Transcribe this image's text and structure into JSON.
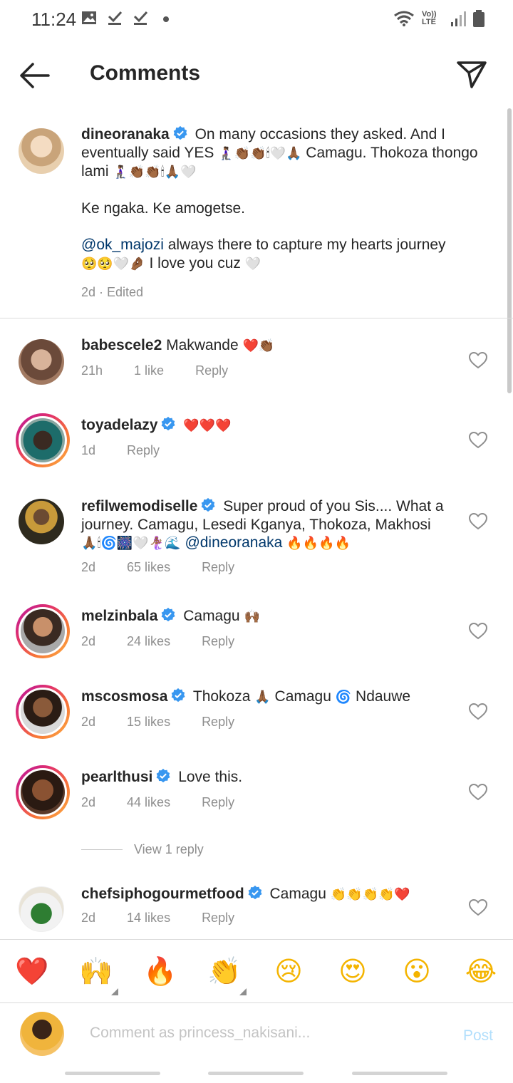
{
  "status_bar": {
    "time": "11:24",
    "network": "Vo)) LTE"
  },
  "header": {
    "title": "Comments"
  },
  "caption": {
    "username": "dineoranaka",
    "text_1": "On many occasions they asked. And I eventually said YES",
    "emoji_1": "🧎🏾‍♀️👏🏾👏🏾🕯🤍🙏🏾",
    "text_2": "Camagu. Thokoza thongo lami",
    "emoji_2": "🧎🏾‍♀️👏🏾👏🏾🕯🙏🏾🤍",
    "text_3": "Ke ngaka. Ke amogetse.",
    "mention": "@ok_majozi",
    "text_4": "always there to capture my hearts journey",
    "emoji_4": "🥺🥺🤍🤌🏾",
    "text_5": "I love you cuz",
    "emoji_5": "🤍",
    "meta": "2d · Edited"
  },
  "comments": [
    {
      "username": "babescele2",
      "text": "Makwande",
      "emoji": "❤️👏🏾",
      "time": "21h",
      "likes": "1 like",
      "reply": "Reply"
    },
    {
      "username": "toyadelazy",
      "text": "",
      "emoji": "❤️❤️❤️",
      "time": "1d",
      "likes": "",
      "reply": "Reply"
    },
    {
      "username": "refilwemodiselle",
      "text": "Super proud of you Sis.... What a journey. Camagu, Lesedi Kganya, Thokoza, Makhosi",
      "emoji": "🙏🏾🕯🌀🎆🤍🧜🏾‍♀️🌊",
      "mention": "@dineoranaka",
      "emoji_after": "🔥🔥🔥🔥",
      "time": "2d",
      "likes": "65 likes",
      "reply": "Reply"
    },
    {
      "username": "melzinbala",
      "text": "Camagu",
      "emoji": "🙌🏾",
      "time": "2d",
      "likes": "24 likes",
      "reply": "Reply"
    },
    {
      "username": "mscosmosa",
      "text_a": "Thokoza",
      "emoji_a": "🙏🏾",
      "text_b": "Camagu",
      "emoji_b": "🌀",
      "text_c": "Ndauwe",
      "time": "2d",
      "likes": "15 likes",
      "reply": "Reply"
    },
    {
      "username": "pearlthusi",
      "text": "Love this.",
      "emoji": "",
      "time": "2d",
      "likes": "44 likes",
      "reply": "Reply"
    },
    {
      "username": "chefsiphogourmetfood",
      "text": "Camagu",
      "emoji": "👏👏👏👏❤️",
      "time": "2d",
      "likes": "14 likes",
      "reply": "Reply"
    }
  ],
  "view_replies": "View 1 reply",
  "emoji_bar": [
    "❤️",
    "🙌",
    "🔥",
    "👏",
    "😢",
    "😍",
    "😮",
    "😂"
  ],
  "composer": {
    "placeholder": "Comment as princess_nakisani...",
    "post_label": "Post"
  },
  "colors": {
    "link": "#00376b",
    "verified": "#3897f0",
    "muted": "#8e8e8e",
    "post_disabled": "#b2dffc"
  }
}
